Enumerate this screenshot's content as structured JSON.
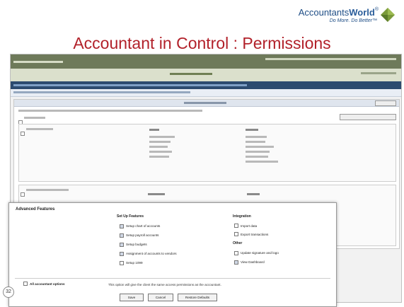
{
  "logo": {
    "name_plain": "Accountants",
    "name_bold": "World",
    "mark": "®",
    "tagline": "Do More. Do Better™"
  },
  "slide": {
    "title": "Accountant in Control : Permissions",
    "page_number": "32"
  },
  "advanced_features": {
    "title": "Advanced Features",
    "setup_header": "Set Up Features",
    "setup_options": [
      {
        "label": "Setup chart of accounts",
        "checked": true
      },
      {
        "label": "Setup payroll accounts",
        "checked": true
      },
      {
        "label": "Setup budgets",
        "checked": true
      },
      {
        "label": "Assignment of accounts to vendors",
        "checked": true
      },
      {
        "label": "Setup 1099",
        "checked": false
      }
    ],
    "integration_header": "Integration",
    "integration_options": [
      {
        "label": "Import data",
        "checked": false
      },
      {
        "label": "Export transactions",
        "checked": false
      }
    ],
    "other_header": "Other",
    "other_options": [
      {
        "label": "Update signature and logo",
        "checked": false
      },
      {
        "label": "View Dashboard",
        "checked": true
      }
    ],
    "all_options_label": "All accountant options",
    "all_options_desc": "This option will give the client the same access permissions as the accountant.",
    "buttons": {
      "save": "Save",
      "cancel": "Cancel",
      "restore": "Restore Defaults"
    }
  }
}
